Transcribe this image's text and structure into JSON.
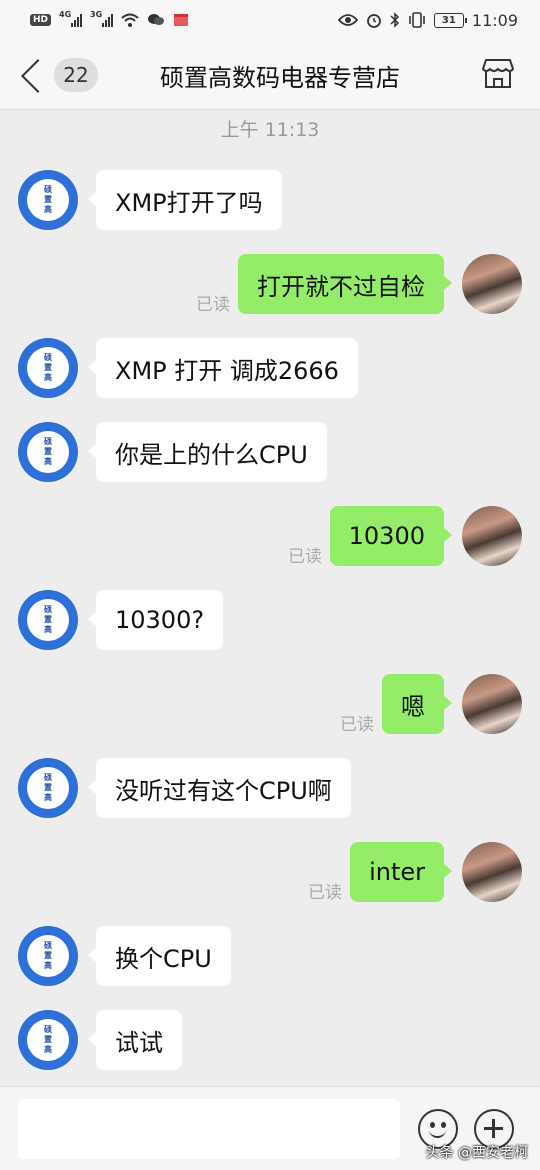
{
  "status_bar": {
    "hd_badge": "HD",
    "sim1_network": "4G",
    "sim2_network": "3G",
    "battery": "31",
    "time": "11:09"
  },
  "header": {
    "unread_count": "22",
    "title": "硕置高数码电器专营店"
  },
  "chat": {
    "timestamp": "上午 11:13",
    "read_label": "已读",
    "store_avatar_lines": [
      "硕",
      "置",
      "高"
    ],
    "messages": [
      {
        "from": "store",
        "text": "XMP打开了吗"
      },
      {
        "from": "me",
        "text": "打开就不过自检",
        "read": true
      },
      {
        "from": "store",
        "text": "XMP 打开 调成2666"
      },
      {
        "from": "store",
        "text": "你是上的什么CPU"
      },
      {
        "from": "me",
        "text": "10300",
        "read": true
      },
      {
        "from": "store",
        "text": "10300?"
      },
      {
        "from": "me",
        "text": "嗯",
        "read": true
      },
      {
        "from": "store",
        "text": "没听过有这个CPU啊"
      },
      {
        "from": "me",
        "text": "inter",
        "read": true
      },
      {
        "from": "store",
        "text": "换个CPU"
      },
      {
        "from": "store",
        "text": "试试"
      }
    ]
  },
  "input_bar": {
    "placeholder": ""
  },
  "watermark": "头条 @西安老柯",
  "colors": {
    "outgoing_bubble": "#95ec69",
    "incoming_bubble": "#ffffff",
    "background": "#ededed",
    "store_avatar": "#2e6fd8"
  },
  "icons": [
    "back-chevron-icon",
    "store-icon",
    "emoji-icon",
    "plus-icon",
    "wifi-icon",
    "eye-icon",
    "alarm-icon",
    "bluetooth-icon",
    "vibrate-icon"
  ]
}
